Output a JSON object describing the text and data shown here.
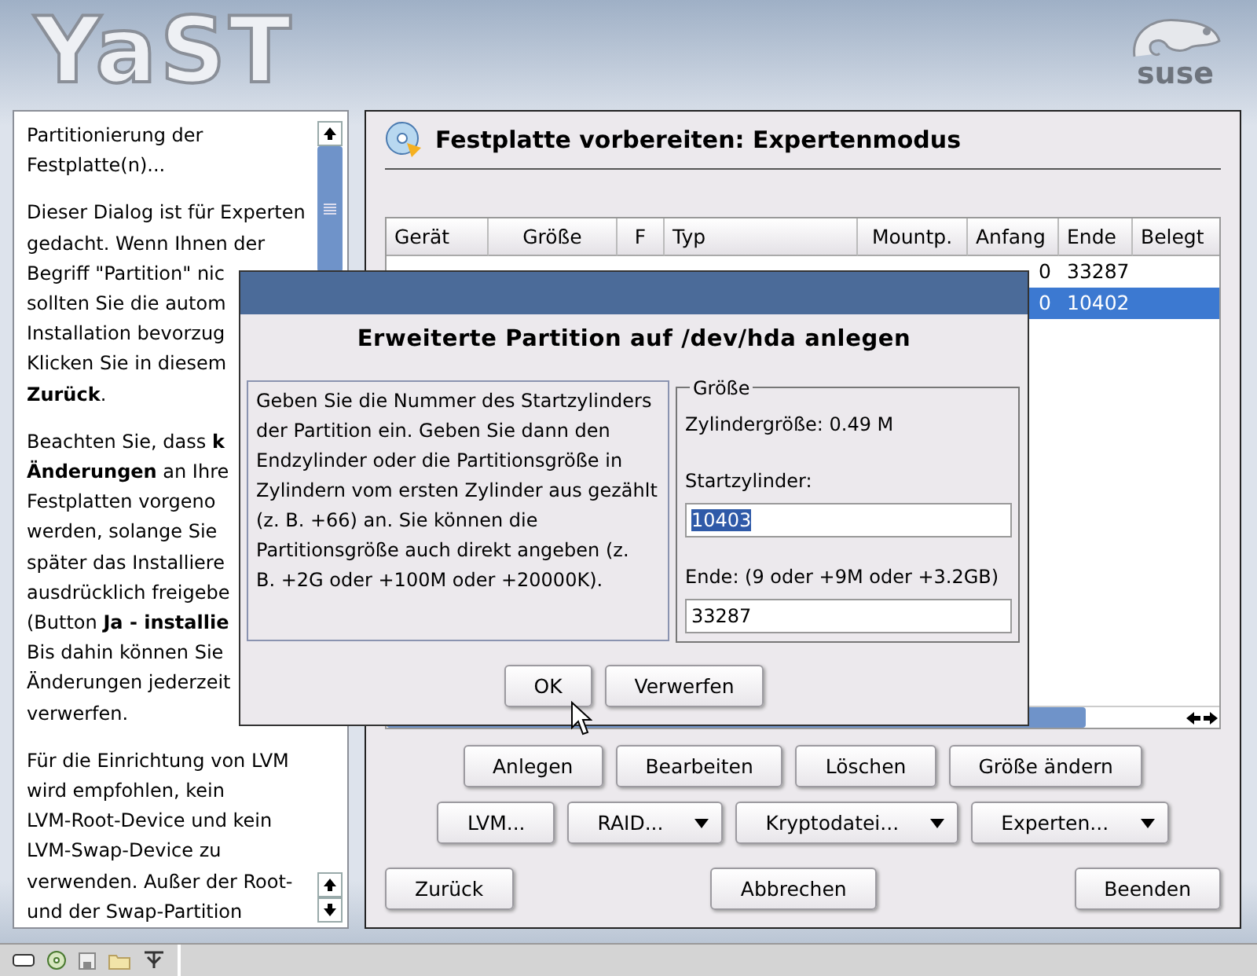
{
  "header": {
    "logo": "YaST",
    "brand": "suse"
  },
  "help": {
    "paragraphs": [
      {
        "lines": [
          "Partitionierung der",
          "Festplatte(n)..."
        ]
      },
      {
        "lines": [
          "Dieser Dialog ist für Experten",
          "gedacht. Wenn Ihnen der",
          "Begriff \"Partition\" nic",
          "sollten Sie die autom",
          "Installation bevorzug",
          "Klicken Sie in diesem",
          "**Zurück**."
        ]
      },
      {
        "lines": [
          "Beachten Sie, dass **k**",
          "**Änderungen** an Ihre",
          "Festplatten vorgeno",
          "werden, solange Sie",
          "später das Installiere",
          "ausdrücklich freigebe",
          "(Button **Ja - installie**",
          "Bis dahin können Sie",
          "Änderungen jederzeit",
          "verwerfen."
        ]
      },
      {
        "lines": [
          "Für die Einrichtung von LVM",
          "wird empfohlen, kein",
          "LVM-Root-Device und kein",
          "LVM-Swap-Device zu",
          "verwenden. Außer der Root-",
          "und der Swap-Partition"
        ]
      }
    ]
  },
  "main": {
    "title": "Festplatte vorbereiten: Expertenmodus",
    "table": {
      "columns": [
        "Gerät",
        "Größe",
        "F",
        "Typ",
        "Mountp.",
        "Anfang",
        "Ende",
        "Belegt"
      ],
      "rows": [
        {
          "selected": false,
          "cells": [
            "",
            "",
            "",
            "",
            "",
            "0",
            "33287",
            ""
          ]
        },
        {
          "selected": true,
          "cells": [
            "",
            "",
            "",
            "",
            "",
            "0",
            "10402",
            ""
          ]
        }
      ]
    },
    "button_rows": [
      [
        {
          "label": "Anlegen",
          "menu": false
        },
        {
          "label": "Bearbeiten",
          "menu": false
        },
        {
          "label": "Löschen",
          "menu": false
        },
        {
          "label": "Größe ändern",
          "menu": false
        }
      ],
      [
        {
          "label": "LVM...",
          "menu": false
        },
        {
          "label": "RAID...",
          "menu": true
        },
        {
          "label": "Kryptodatei...",
          "menu": true
        },
        {
          "label": "Experten...",
          "menu": true
        }
      ]
    ],
    "nav_buttons": [
      "Zurück",
      "Abbrechen",
      "Beenden"
    ]
  },
  "dialog": {
    "title": "Erweiterte Partition auf /dev/hda anlegen",
    "help_lines": [
      "Geben Sie die Nummer des Startzylinders",
      "der Partition ein. Geben Sie dann den",
      "Endzylinder oder die Partitionsgröße in",
      "Zylindern vom ersten Zylinder aus gezählt",
      "(z. B. +66) an. Sie können die",
      "Partitionsgröße auch direkt angeben (z.",
      "B. +2G oder +100M oder +20000K)."
    ],
    "group_title": "Größe",
    "cylinder_size": "Zylindergröße: 0.49 M",
    "start_label": "Startzylinder:",
    "start_value": "10403",
    "start_value_selected": true,
    "end_label": "Ende:  (9 oder +9M oder +3.2GB)",
    "end_value": "33287",
    "buttons": [
      "OK",
      "Verwerfen"
    ]
  }
}
